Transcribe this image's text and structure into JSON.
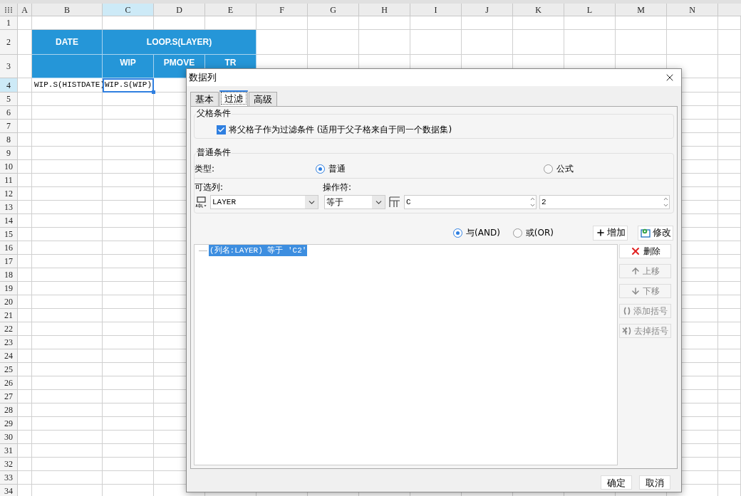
{
  "sheet": {
    "columns": [
      {
        "label": "A",
        "selected": false
      },
      {
        "label": "B",
        "selected": false
      },
      {
        "label": "C",
        "selected": true
      },
      {
        "label": "D",
        "selected": false
      },
      {
        "label": "E",
        "selected": false
      },
      {
        "label": "F",
        "selected": false
      },
      {
        "label": "G",
        "selected": false
      },
      {
        "label": "H",
        "selected": false
      },
      {
        "label": "I",
        "selected": false
      },
      {
        "label": "J",
        "selected": false
      },
      {
        "label": "K",
        "selected": false
      },
      {
        "label": "L",
        "selected": false
      },
      {
        "label": "M",
        "selected": false
      },
      {
        "label": "N",
        "selected": false
      }
    ],
    "rows": [
      {
        "label": "1",
        "selected": false
      },
      {
        "label": "2",
        "selected": false
      },
      {
        "label": "3",
        "selected": false
      },
      {
        "label": "4",
        "selected": true
      },
      {
        "label": "5",
        "selected": false
      },
      {
        "label": "6",
        "selected": false
      },
      {
        "label": "7",
        "selected": false
      },
      {
        "label": "8",
        "selected": false
      },
      {
        "label": "9",
        "selected": false
      },
      {
        "label": "10",
        "selected": false
      },
      {
        "label": "11",
        "selected": false
      },
      {
        "label": "12",
        "selected": false
      },
      {
        "label": "13",
        "selected": false
      },
      {
        "label": "14",
        "selected": false
      },
      {
        "label": "15",
        "selected": false
      },
      {
        "label": "16",
        "selected": false
      },
      {
        "label": "17",
        "selected": false
      },
      {
        "label": "18",
        "selected": false
      },
      {
        "label": "19",
        "selected": false
      },
      {
        "label": "20",
        "selected": false
      },
      {
        "label": "21",
        "selected": false
      },
      {
        "label": "22",
        "selected": false
      },
      {
        "label": "23",
        "selected": false
      },
      {
        "label": "24",
        "selected": false
      },
      {
        "label": "25",
        "selected": false
      },
      {
        "label": "26",
        "selected": false
      },
      {
        "label": "27",
        "selected": false
      },
      {
        "label": "28",
        "selected": false
      },
      {
        "label": "29",
        "selected": false
      },
      {
        "label": "30",
        "selected": false
      },
      {
        "label": "31",
        "selected": false
      },
      {
        "label": "32",
        "selected": false
      },
      {
        "label": "33",
        "selected": false
      },
      {
        "label": "34",
        "selected": false
      }
    ],
    "cells": [
      {
        "kind": "header",
        "text": "DATE",
        "selected": false
      },
      {
        "kind": "header",
        "text": "LOOP.S(LAYER)",
        "selected": false
      },
      {
        "kind": "header",
        "selected": false
      },
      {
        "kind": "header",
        "text": "WIP",
        "selected": false
      },
      {
        "kind": "header",
        "text": "PMOVE",
        "selected": false
      },
      {
        "kind": "header",
        "text": "TR",
        "selected": false
      },
      {
        "kind": "formula",
        "text": "WIP.S(HISTDATE)",
        "selected": false
      },
      {
        "kind": "formula",
        "text": "WIP.S(WIP)",
        "selected": true
      }
    ]
  },
  "dialog": {
    "title": "数据列",
    "tabs": [
      {
        "label": "基本",
        "selected": false
      },
      {
        "label": "过滤",
        "selected": true
      },
      {
        "label": "高级",
        "selected": false
      }
    ],
    "parent_group": {
      "legend": "父格条件",
      "checkbox": {
        "label": "将父格子作为过滤条件 (适用于父子格来自于同一个数据集)",
        "checked": true
      }
    },
    "normal_group": {
      "legend": "普通条件",
      "type_label": "类型:",
      "type_options": [
        {
          "label": "普通",
          "selected": true
        },
        {
          "label": "公式",
          "selected": false
        }
      ],
      "column_label": "可选列:",
      "operator_label": "操作符:",
      "column_value": "LAYER",
      "operator_value": "等于",
      "value_1": "C",
      "value_2": "2"
    },
    "logic_options": [
      {
        "label": "与(AND)",
        "selected": true
      },
      {
        "label": "或(OR)",
        "selected": false
      }
    ],
    "add_button": "增加",
    "modify_button": "修改",
    "conditions": [
      {
        "text": "(列名:LAYER) 等于 'C2'",
        "selected": true
      }
    ],
    "side_buttons": [
      {
        "kind": "delete",
        "label": "删除",
        "disabled": false
      },
      {
        "kind": "up",
        "label": "上移",
        "disabled": true
      },
      {
        "kind": "down",
        "label": "下移",
        "disabled": true
      },
      {
        "kind": "add_bracket",
        "label": "添加括号",
        "disabled": true
      },
      {
        "kind": "remove_bracket",
        "label": "去掉括号",
        "disabled": true
      }
    ],
    "footer_buttons": [
      "确定",
      "取消"
    ]
  }
}
